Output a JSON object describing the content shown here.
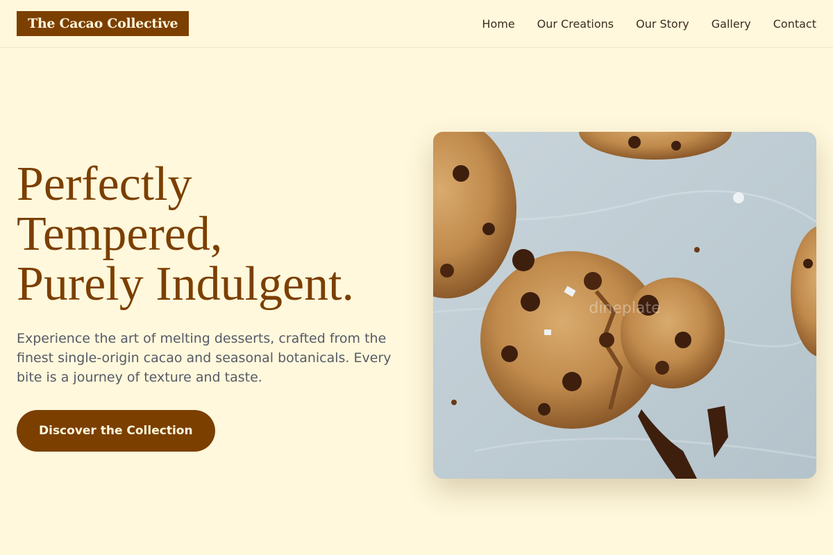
{
  "header": {
    "logo": "The Cacao Collective",
    "nav": [
      "Home",
      "Our Creations",
      "Our Story",
      "Gallery",
      "Contact"
    ]
  },
  "hero": {
    "headline_lines": [
      "Perfectly",
      "Tempered,",
      "Purely Indulgent."
    ],
    "subtitle": "Experience the art of melting desserts, crafted from the finest single-origin cacao and seasonal botanicals. Every bite is a journey of texture and taste.",
    "cta_label": "Discover the Collection",
    "image_watermark": "dineplate"
  },
  "colors": {
    "background": "#fff8dc",
    "brand": "#7b3f00",
    "body_text": "#575a66"
  }
}
